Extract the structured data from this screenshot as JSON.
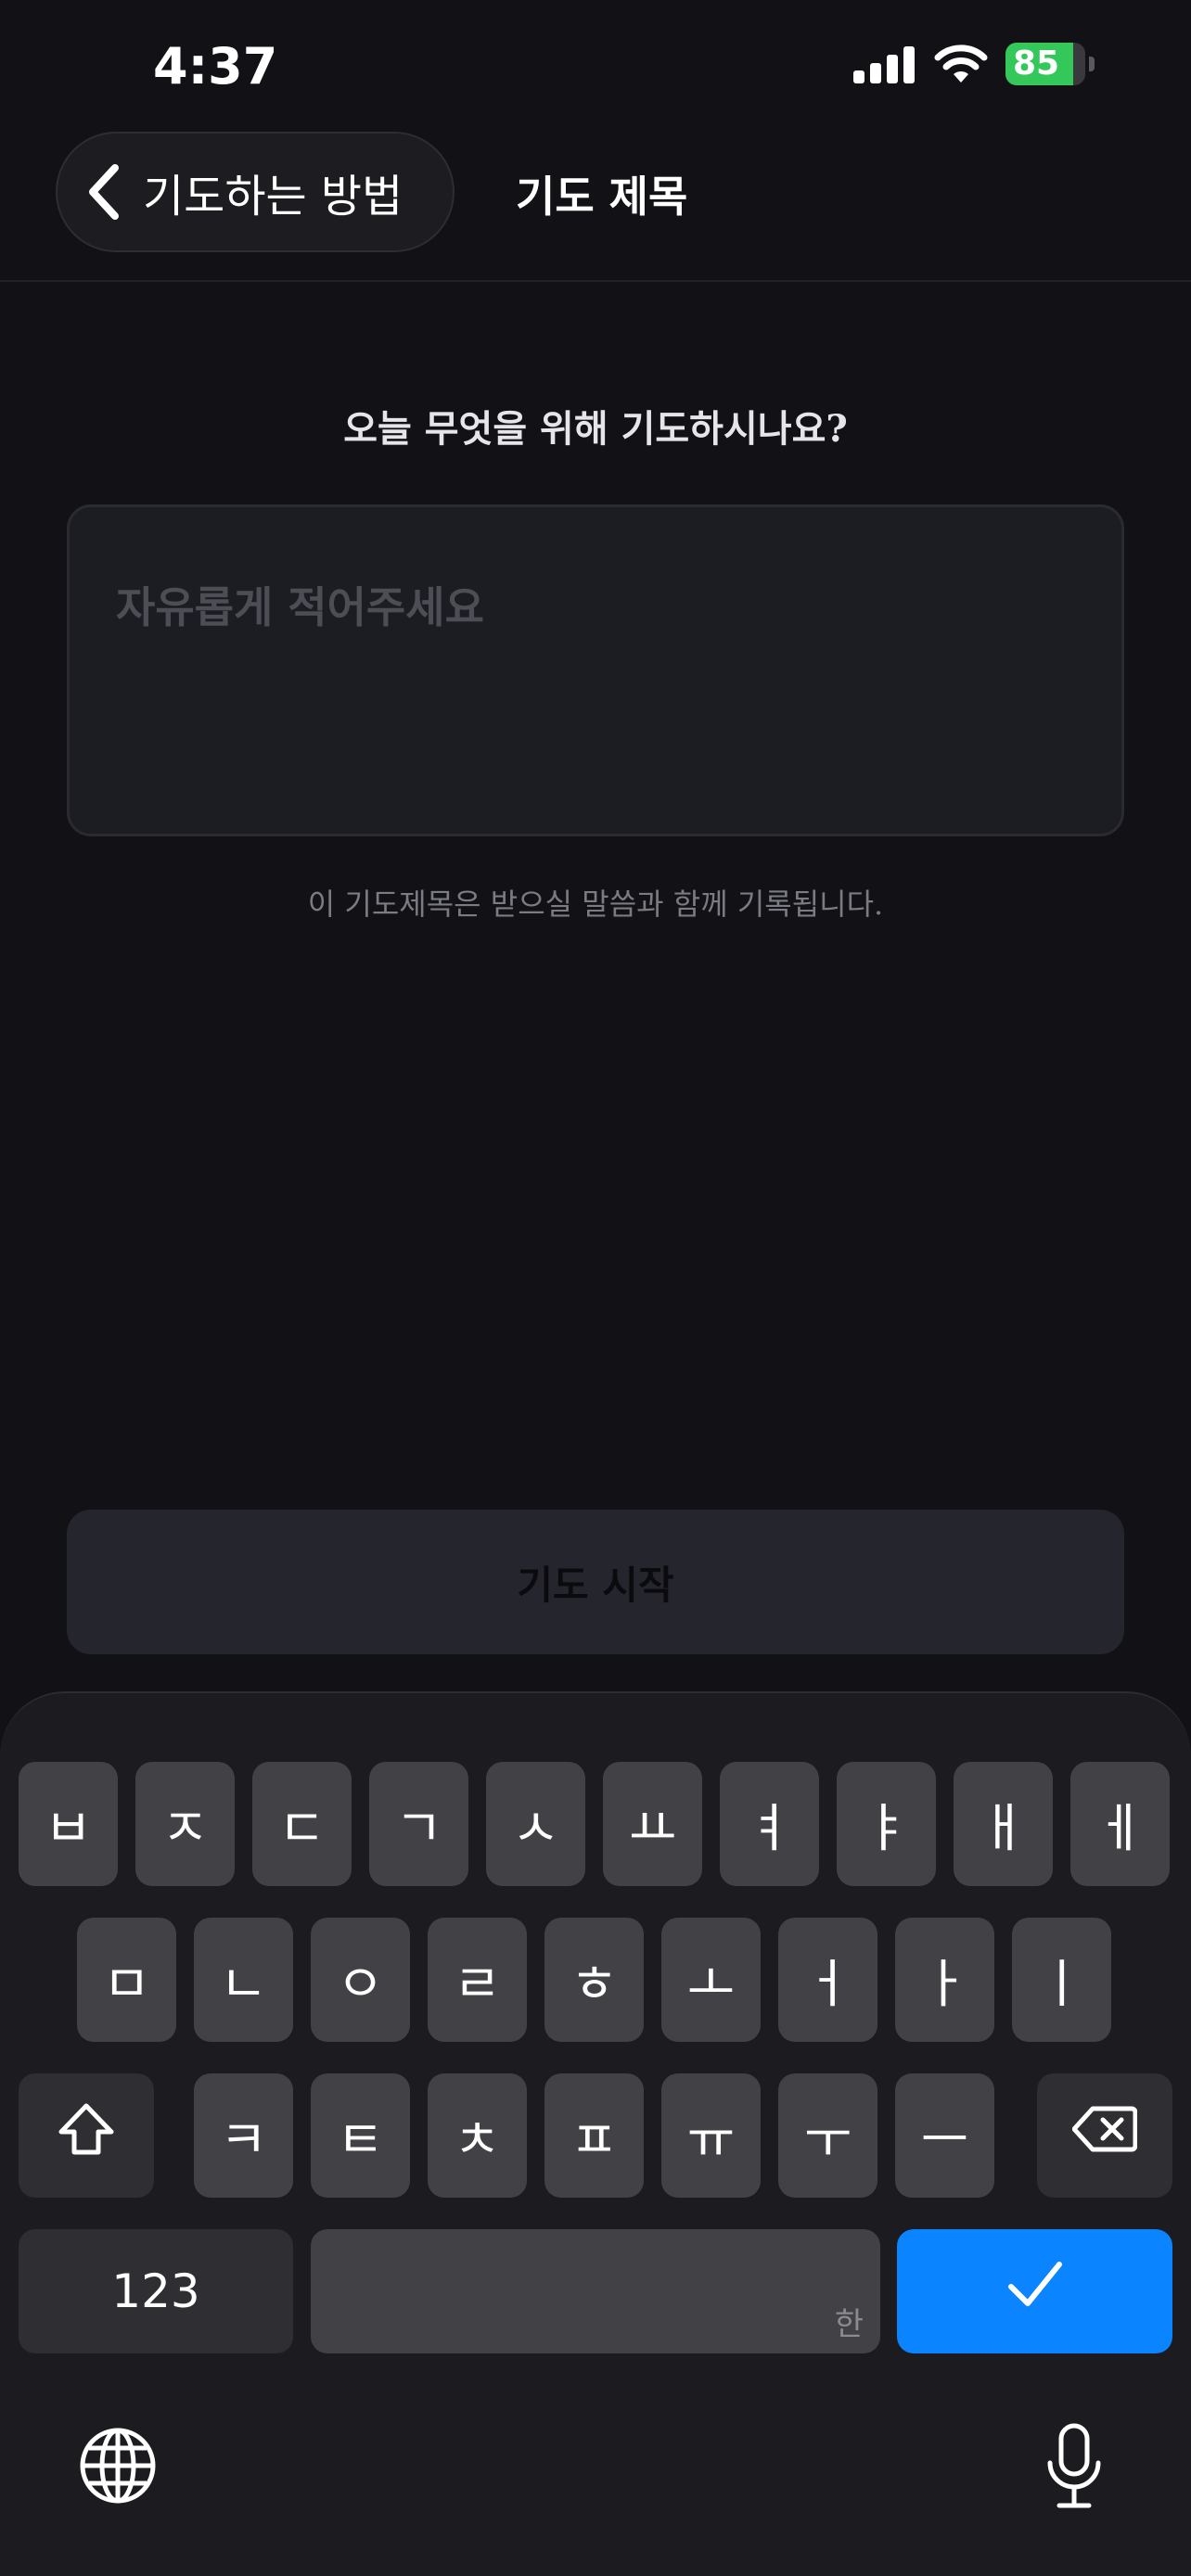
{
  "status": {
    "time": "4:37",
    "battery": "85",
    "battery_level_pct": 85,
    "battery_color": "#34c759",
    "icons": [
      "signal-icon",
      "wifi-icon",
      "battery-charging-icon"
    ]
  },
  "nav": {
    "back_label": "기도하는 방법",
    "title": "기도 제목"
  },
  "main": {
    "question": "오늘 무엇을 위해 기도하시나요?",
    "input_placeholder": "자유롭게 적어주세요",
    "input_value": "",
    "helper": "이 기도제목은 받으실 말씀과 함께 기록됩니다.",
    "start_button": "기도 시작"
  },
  "keyboard": {
    "row1": [
      "ㅂ",
      "ㅈ",
      "ㄷ",
      "ㄱ",
      "ㅅ",
      "ㅛ",
      "ㅕ",
      "ㅑ",
      "ㅐ",
      "ㅔ"
    ],
    "row2": [
      "ㅁ",
      "ㄴ",
      "ㅇ",
      "ㄹ",
      "ㅎ",
      "ㅗ",
      "ㅓ",
      "ㅏ",
      "ㅣ"
    ],
    "row3": [
      "ㅋ",
      "ㅌ",
      "ㅊ",
      "ㅍ",
      "ㅠ",
      "ㅜ",
      "ㅡ"
    ],
    "numbers_key": "123",
    "space_language": "한",
    "accent_color": "#0a84ff",
    "icons": [
      "shift-icon",
      "delete-icon",
      "checkmark-icon",
      "globe-icon",
      "microphone-icon"
    ]
  }
}
